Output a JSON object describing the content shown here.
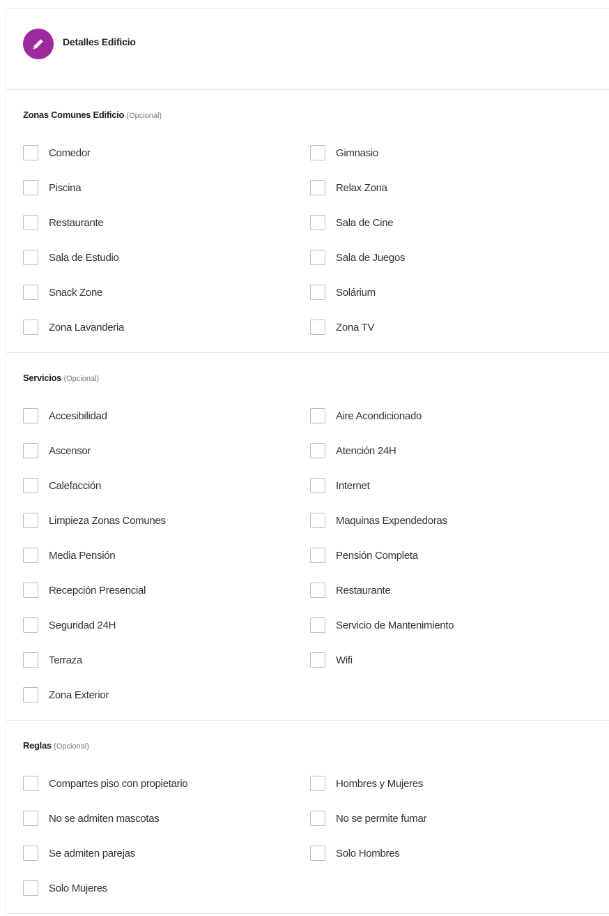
{
  "header": {
    "title": "Detalles Edificio",
    "icon": "pencil-icon",
    "accent": "#9b2a9c"
  },
  "sections": [
    {
      "title": "Zonas Comunes Edificio",
      "optional": "(Opcional)",
      "options": [
        "Comedor",
        "Gimnasio",
        "Piscina",
        "Relax Zona",
        "Restaurante",
        "Sala de Cine",
        "Sala de Estudio",
        "Sala de Juegos",
        "Snack Zone",
        "Solárium",
        "Zona Lavanderia",
        "Zona TV"
      ]
    },
    {
      "title": "Servicios",
      "optional": "(Opcional)",
      "options": [
        "Accesibilidad",
        "Aire Acondicionado",
        "Ascensor",
        "Atención 24H",
        "Calefacción",
        "Internet",
        "Limpieza Zonas Comunes",
        "Maquinas Expendedoras",
        "Media Pensión",
        "Pensión Completa",
        "Recepción Presencial",
        "Restaurante",
        "Seguridad 24H",
        "Servicio de Mantenimiento",
        "Terraza",
        "Wifi",
        "Zona Exterior"
      ]
    },
    {
      "title": "Reglas",
      "optional": "(Opcional)",
      "options": [
        "Compartes piso con propietario",
        "Hombres y Mujeres",
        "No se admiten mascotas",
        "No se permite fumar",
        "Se admiten parejas",
        "Solo Hombres",
        "Solo Mujeres"
      ]
    }
  ]
}
